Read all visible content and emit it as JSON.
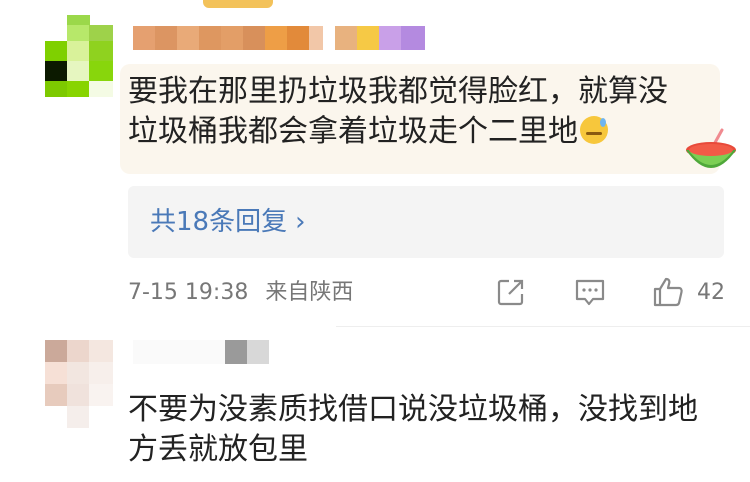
{
  "comments": [
    {
      "text_line1": "要我在那里扔垃圾我都觉得脸红，就算没",
      "text_line2": "垃圾桶我都会拿着垃圾走个二里地",
      "replies_label": "共18条回复",
      "date": "7-15 19:38",
      "location": "来自陕西",
      "likes": "42"
    },
    {
      "text_line1": "不要为没素质找借口说没垃圾桶，没找到地",
      "text_line2": "方丢就放包里"
    }
  ],
  "colors": {
    "accent_link": "#4a79b8",
    "bubble_bg": "#fbf6ed",
    "meta_text": "#777777"
  },
  "icons": [
    "sweat-smile-emoji-icon",
    "watermelon-sticker-icon",
    "share-icon",
    "comment-icon",
    "like-icon",
    "chevron-right-icon"
  ]
}
